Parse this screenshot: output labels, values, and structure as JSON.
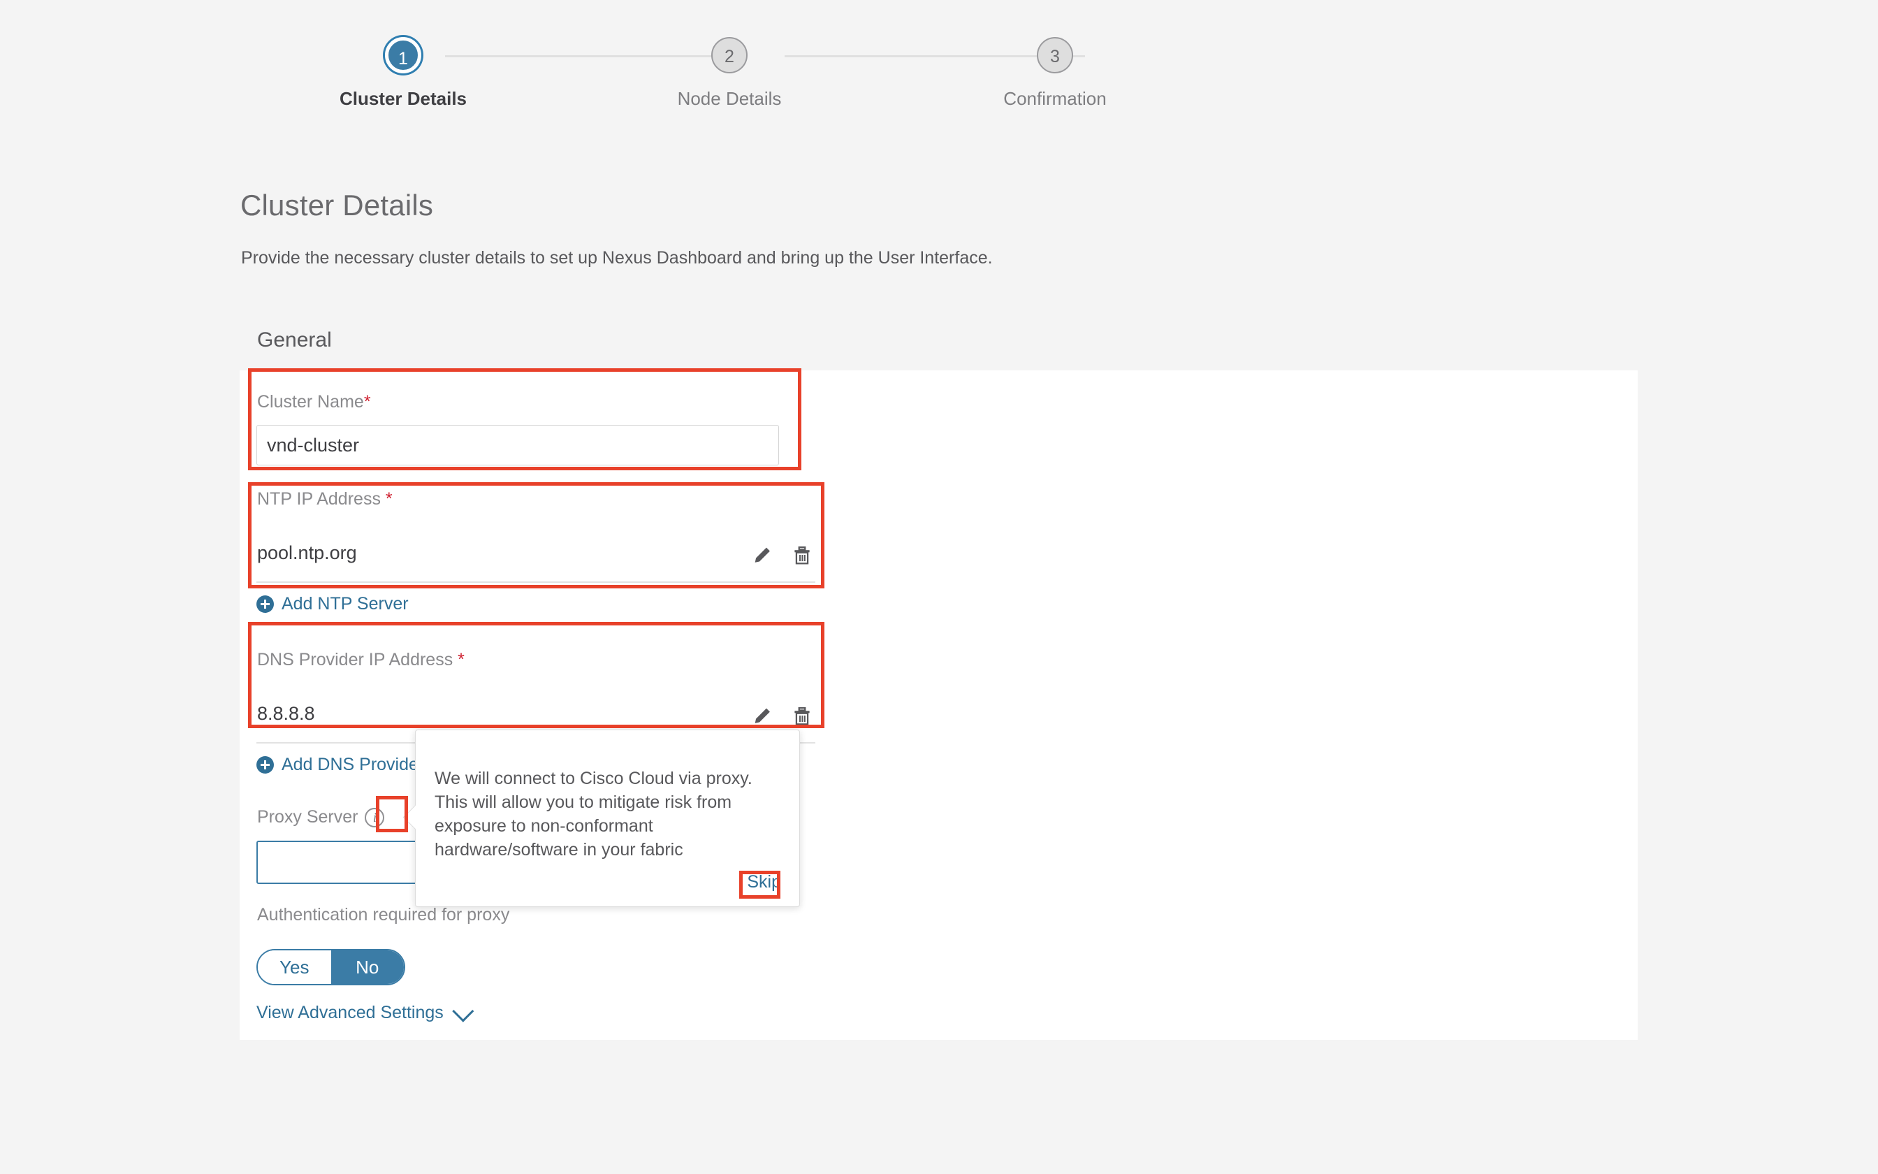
{
  "stepper": {
    "steps": [
      {
        "number": "1",
        "label": "Cluster Details",
        "state": "active"
      },
      {
        "number": "2",
        "label": "Node Details",
        "state": "inactive"
      },
      {
        "number": "3",
        "label": "Confirmation",
        "state": "inactive"
      }
    ],
    "active_color": "#3b7ca6",
    "inactive_color": "#dedede"
  },
  "page": {
    "title": "Cluster Details",
    "subtitle": "Provide the necessary cluster details to set up Nexus Dashboard and bring up the User Interface."
  },
  "general": {
    "section_heading": "General",
    "cluster_name": {
      "label": "Cluster Name",
      "required_mark": "*",
      "value": "vnd-cluster",
      "placeholder": ""
    },
    "ntp": {
      "label": "NTP IP Address",
      "required_mark": "*",
      "value": "pool.ntp.org",
      "edit_icon": "pencil-icon",
      "delete_icon": "trash-icon",
      "add_link": "Add NTP Server",
      "add_icon": "plus-circle-icon"
    },
    "dns": {
      "label": "DNS Provider IP Address",
      "required_mark": "*",
      "value": "8.8.8.8",
      "edit_icon": "pencil-icon",
      "delete_icon": "trash-icon",
      "add_link": "Add DNS Provider",
      "add_icon": "plus-circle-icon"
    },
    "proxy": {
      "label": "Proxy Server",
      "info_icon": "info-circle-icon",
      "value": "",
      "placeholder": ""
    },
    "auth": {
      "label": "Authentication required for proxy",
      "options": [
        "Yes",
        "No"
      ],
      "selected": "No"
    },
    "advanced": {
      "label": "View Advanced Settings",
      "chevron_icon": "chevron-down-icon"
    }
  },
  "tooltip": {
    "text": "We will connect to Cisco Cloud via proxy. This will allow you to mitigate risk from exposure to non-conformant hardware/software in your fabric",
    "skip_label": "Skip"
  },
  "annotations": {
    "color": "#e8412a",
    "boxes": [
      "cluster-name-field",
      "ntp-ip-address-field",
      "dns-provider-ip-address-field",
      "proxy-info-icon",
      "tooltip-skip-link"
    ]
  }
}
